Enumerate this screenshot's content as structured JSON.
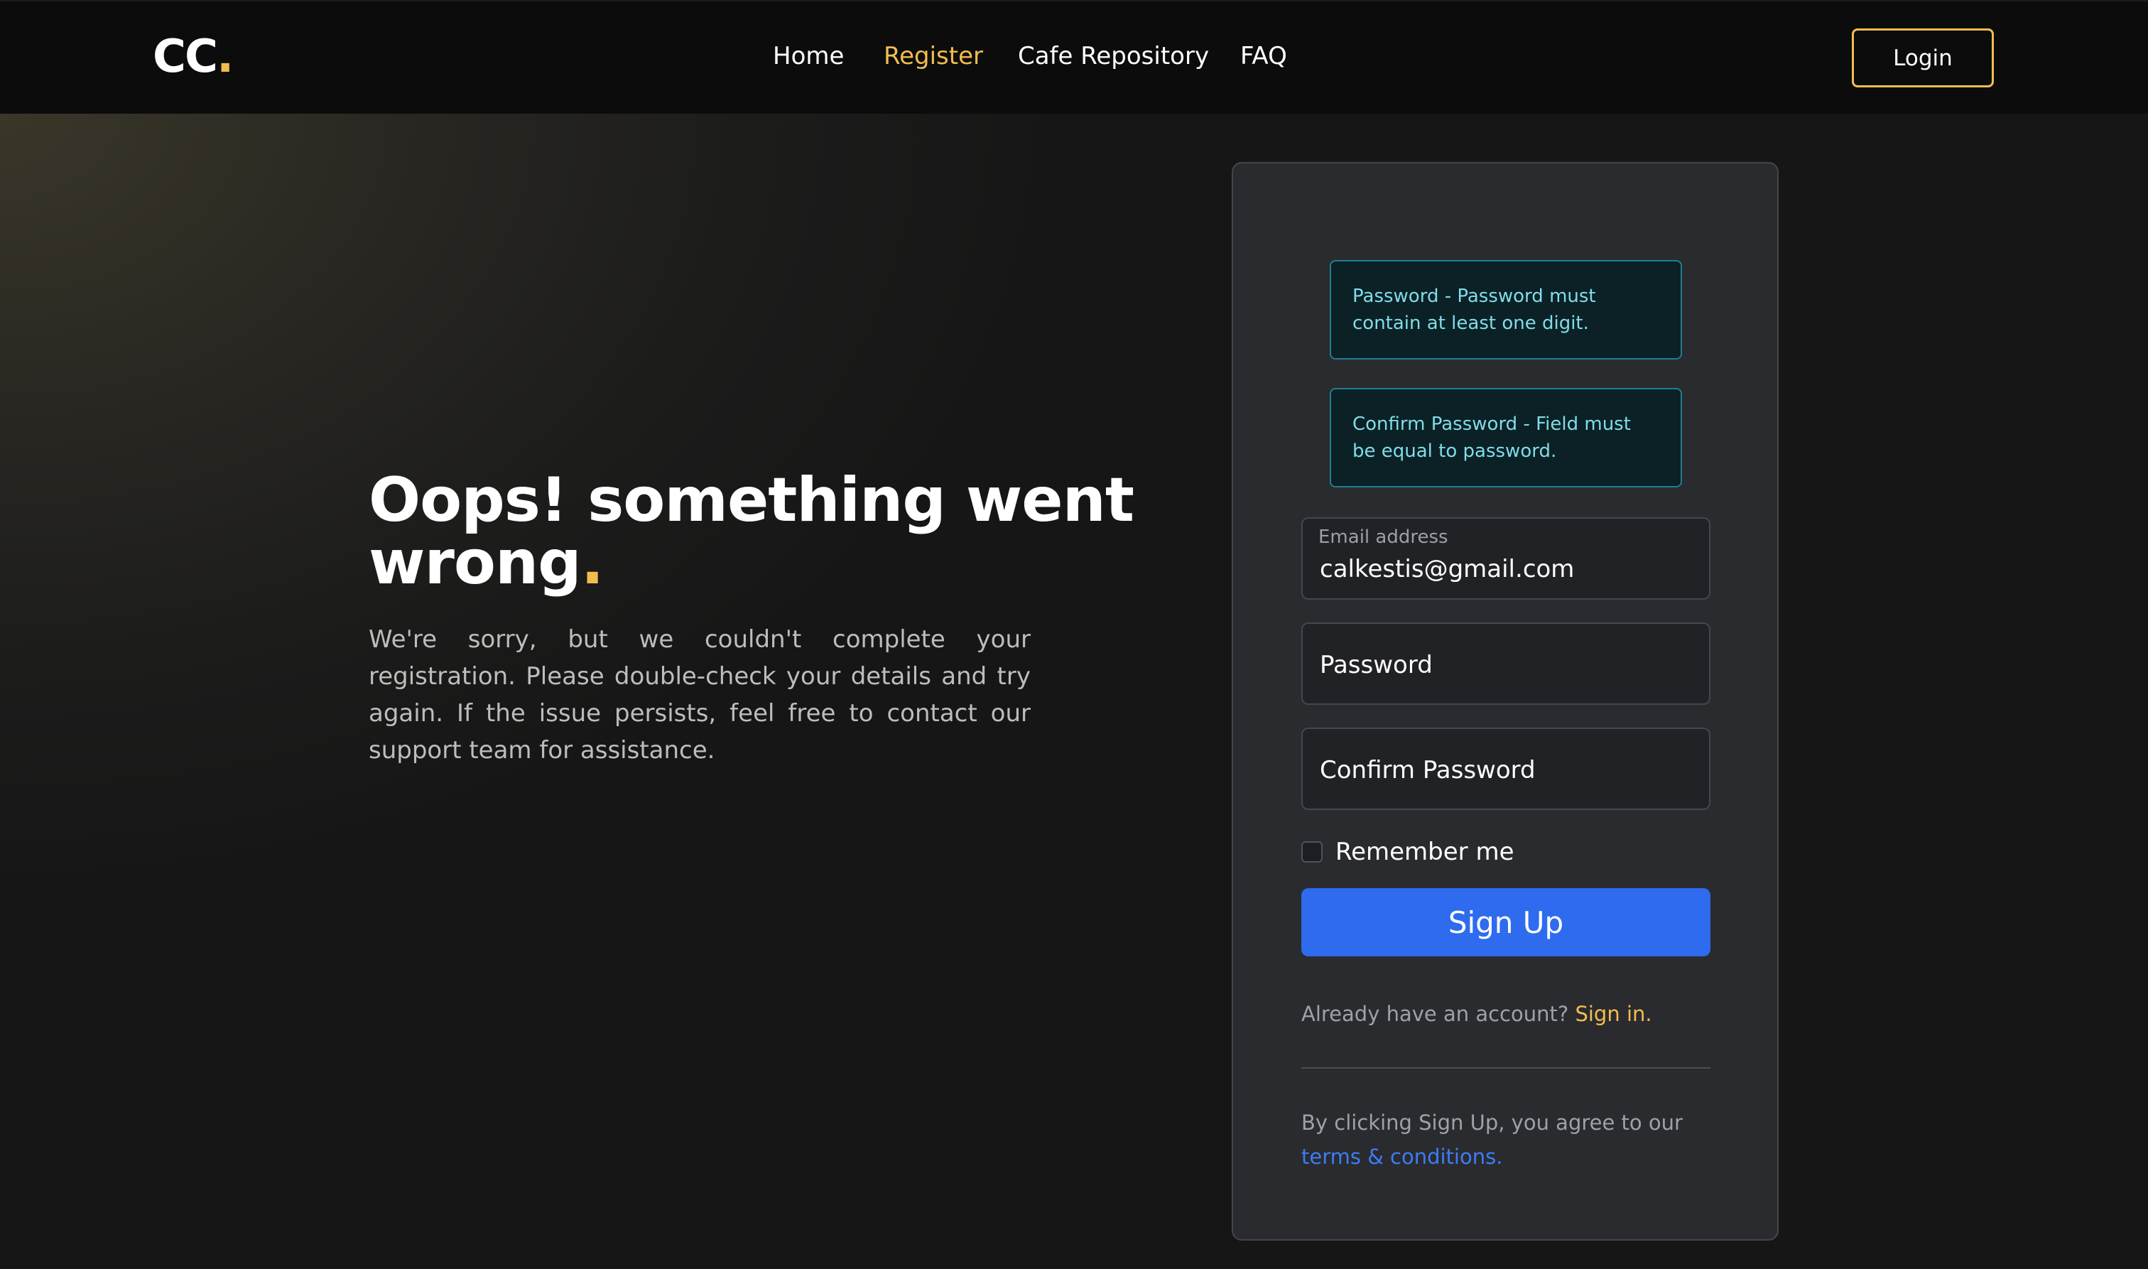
{
  "brand": {
    "logo_text": "CC",
    "logo_dot": "."
  },
  "nav": {
    "items": [
      {
        "label": "Home",
        "active": false
      },
      {
        "label": "Register",
        "active": true
      },
      {
        "label": "Cafe Repository",
        "active": false
      },
      {
        "label": "FAQ",
        "active": false
      }
    ],
    "login_label": "Login"
  },
  "hero": {
    "headline": "Oops! something went wrong",
    "headline_dot": ".",
    "message": "We're sorry, but we couldn't complete your registration. Please double-check your details and try again. If the issue persists, feel free to contact our support team for assistance."
  },
  "form": {
    "alerts": [
      "Password - Password must contain at least one digit.",
      "Confirm Password - Field must be equal to password."
    ],
    "email": {
      "label": "Email address",
      "value": "calkestis@gmail.com"
    },
    "password": {
      "placeholder": "Password"
    },
    "confirm_password": {
      "placeholder": "Confirm Password"
    },
    "remember_label": "Remember me",
    "remember_checked": false,
    "signup_label": "Sign Up",
    "already_text": "Already have an account?",
    "signin_link": "Sign in.",
    "terms_text": "By clicking Sign Up, you agree to our",
    "terms_link": "terms & conditions."
  },
  "colors": {
    "accent": "#f2bd4e",
    "primary_button": "#2e6bef",
    "alert_text": "#7fdde9",
    "alert_border": "#1f7f8e",
    "link_blue": "#3d7cf4"
  }
}
